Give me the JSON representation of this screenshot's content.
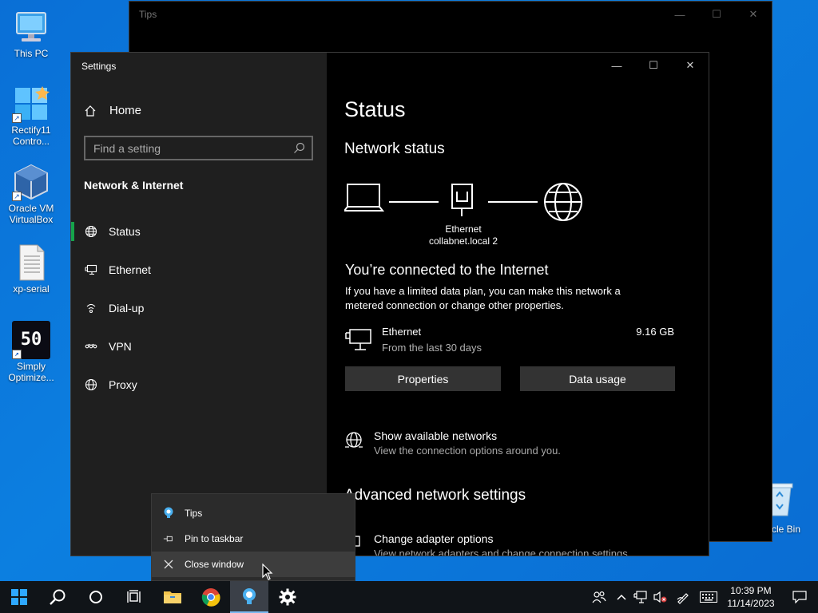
{
  "desktop": {
    "icons": [
      {
        "label": "This PC"
      },
      {
        "label": "Rectify11 Contro..."
      },
      {
        "label": "Oracle VM VirtualBox"
      },
      {
        "label": "xp-serial"
      },
      {
        "label": "Simply Optimize..."
      },
      {
        "label": "ycle Bin"
      }
    ],
    "simply_icon_text": "50"
  },
  "tips_window": {
    "title": "Tips"
  },
  "settings": {
    "window_title": "Settings",
    "home_label": "Home",
    "search_placeholder": "Find a setting",
    "section_title": "Network & Internet",
    "nav": [
      {
        "label": "Status",
        "icon": "globe-icon"
      },
      {
        "label": "Ethernet",
        "icon": "ethernet-icon"
      },
      {
        "label": "Dial-up",
        "icon": "dialup-icon"
      },
      {
        "label": "VPN",
        "icon": "vpn-icon"
      },
      {
        "label": "Proxy",
        "icon": "proxy-icon"
      }
    ],
    "page_title": "Status",
    "network_status_heading": "Network status",
    "adapter_label": "Ethernet",
    "network_name": "collabnet.local 2",
    "connected_title": "You’re connected to the Internet",
    "connected_desc": "If you have a limited data plan, you can make this network a metered connection or change other properties.",
    "usage": {
      "name": "Ethernet",
      "period": "From the last 30 days",
      "amount": "9.16 GB"
    },
    "buttons": {
      "properties": "Properties",
      "data_usage": "Data usage"
    },
    "show_networks": {
      "title": "Show available networks",
      "desc": "View the connection options around you."
    },
    "advanced_heading": "Advanced network settings",
    "adapter_options": {
      "title": "Change adapter options",
      "desc": "View network adapters and change connection settings."
    }
  },
  "context_menu": {
    "items": [
      {
        "label": "Tips",
        "icon": "tips-bulb-icon"
      },
      {
        "label": "Pin to taskbar",
        "icon": "pin-icon"
      },
      {
        "label": "Close window",
        "icon": "close-icon"
      }
    ]
  },
  "taskbar": {
    "clock_time": "10:39 PM",
    "clock_date": "11/14/2023"
  },
  "colors": {
    "accent_green": "#16a34a",
    "desktop_blue": "#0a6fd6",
    "taskbar": "#101418"
  }
}
